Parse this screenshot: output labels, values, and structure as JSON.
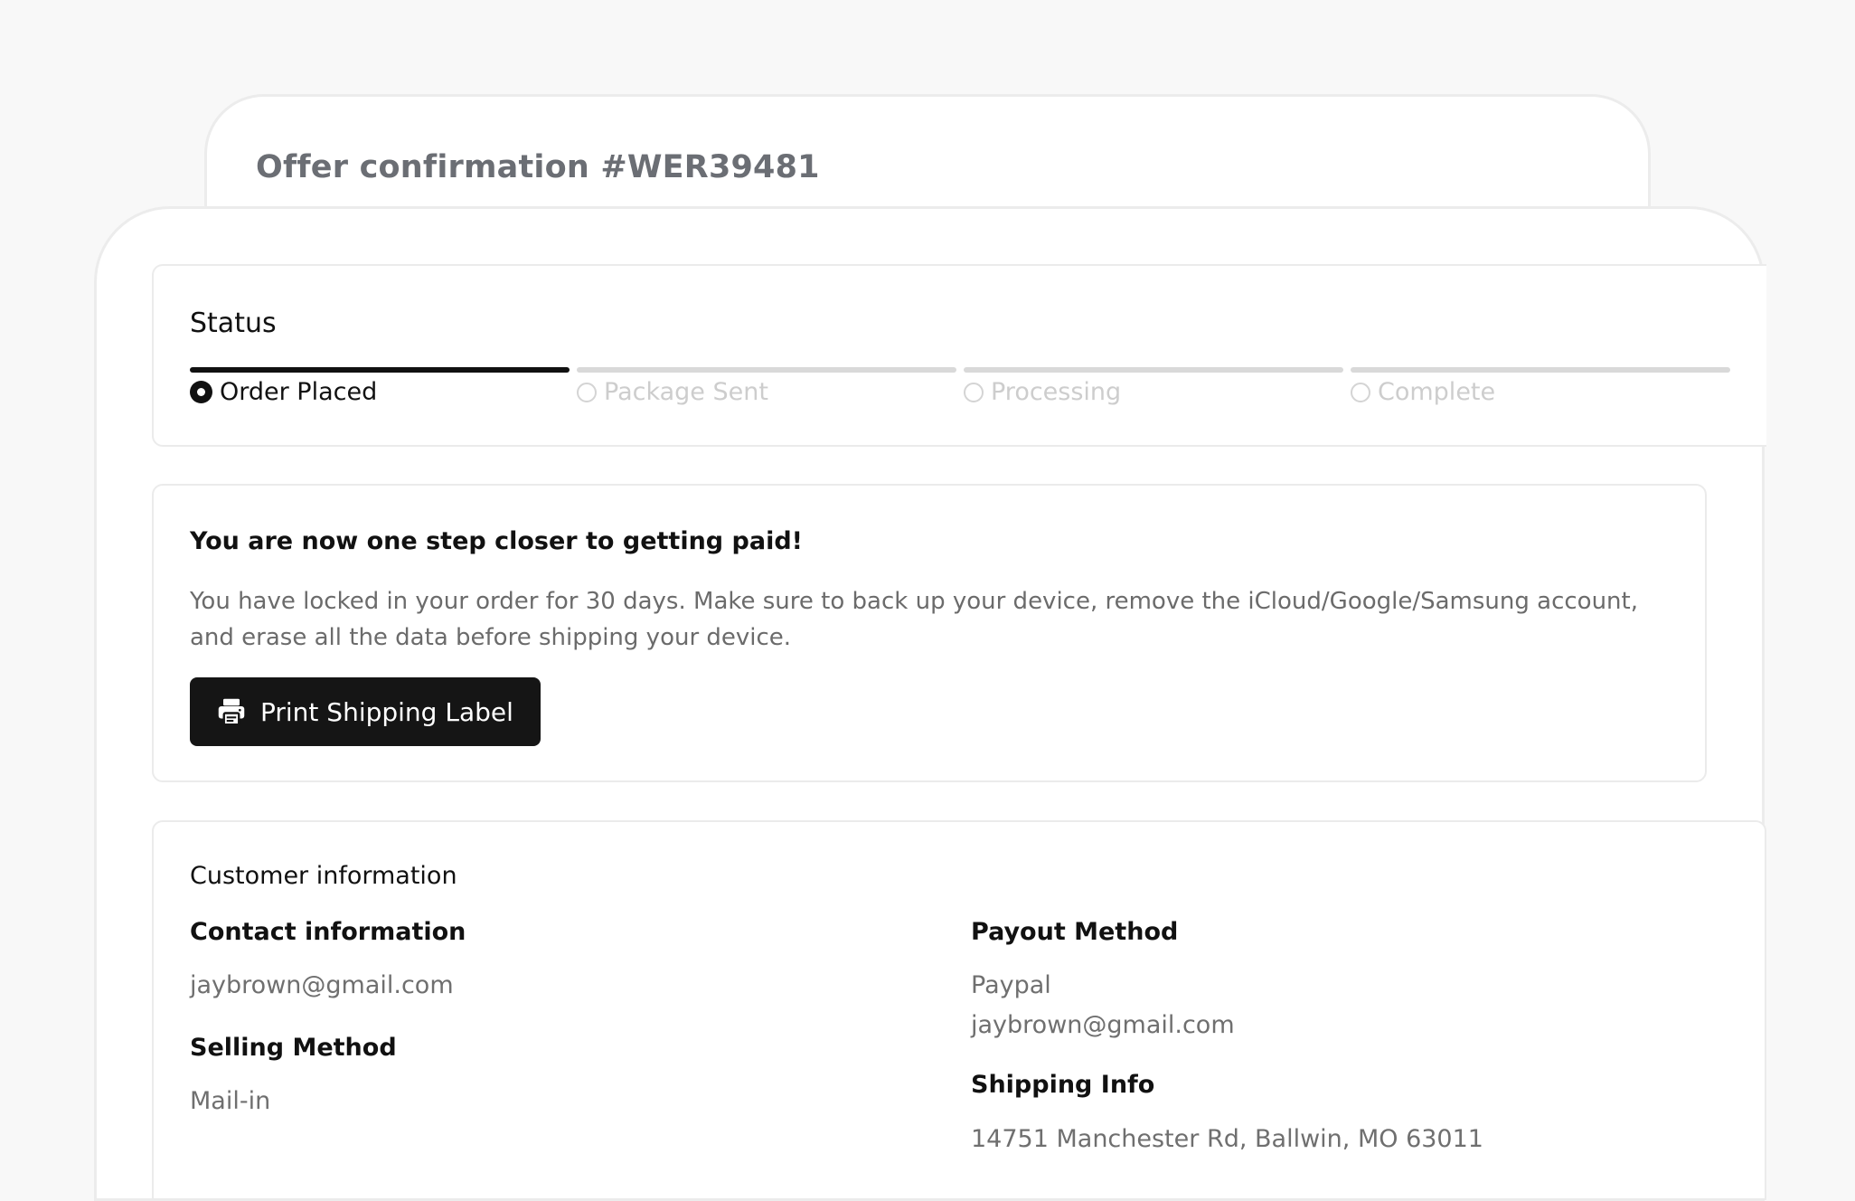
{
  "header": {
    "title": "Offer confirmation #WER39481"
  },
  "status": {
    "title": "Status",
    "steps": [
      {
        "label": "Order Placed",
        "active": true
      },
      {
        "label": "Package Sent",
        "active": false
      },
      {
        "label": "Processing",
        "active": false
      },
      {
        "label": "Complete",
        "active": false
      }
    ]
  },
  "message": {
    "heading": "You are now one step closer to getting paid!",
    "body": "You have locked in your order for 30 days. Make sure to back up your device, remove the iCloud/Google/Samsung account, and erase all the data before shipping your device.",
    "button_label": "Print Shipping Label",
    "button_icon": "printer-icon"
  },
  "customer": {
    "title": "Customer information",
    "contact_label": "Contact information",
    "contact_value": "jaybrown@gmail.com",
    "selling_method_label": "Selling Method",
    "selling_method_value": "Mail-in",
    "payout_label": "Payout Method",
    "payout_provider": "Paypal",
    "payout_email": "jaybrown@gmail.com",
    "shipping_label": "Shipping Info",
    "shipping_address": "14751 Manchester Rd, Ballwin, MO 63011"
  },
  "colors": {
    "background": "#f8f8f8",
    "card": "#ffffff",
    "primary_button": "#151515",
    "active_step": "#111111",
    "inactive_step": "#d9d9d9",
    "muted_text": "#6b6b6b"
  }
}
